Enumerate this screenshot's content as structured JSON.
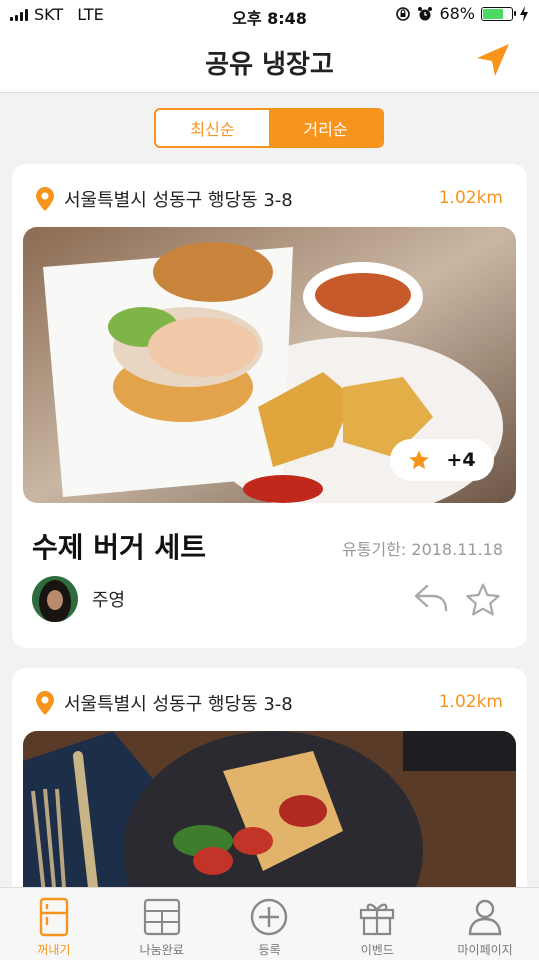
{
  "status_bar": {
    "carrier": "SKT",
    "network": "LTE",
    "time": "오후 8:48",
    "battery": "68%"
  },
  "header": {
    "title": "공유 냉장고"
  },
  "sort_tabs": [
    {
      "label": "최신순",
      "active": false
    },
    {
      "label": "거리순",
      "active": true
    }
  ],
  "cards": [
    {
      "location": "서울특별시 성동구 행당동 3-8",
      "distance": "1.02km",
      "photo_count": "+4",
      "title": "수제 버거 세트",
      "expiry": "유통기한: 2018.11.18",
      "user": "주영"
    },
    {
      "location": "서울특별시 성동구 행당동 3-8",
      "distance": "1.02km"
    }
  ],
  "tab_bar": [
    {
      "label": "꺼내기",
      "icon": "fridge-icon",
      "active": true
    },
    {
      "label": "나눔완료",
      "icon": "shelf-icon",
      "active": false
    },
    {
      "label": "등록",
      "icon": "plus-circle-icon",
      "active": false
    },
    {
      "label": "이벤드",
      "icon": "gift-icon",
      "active": false
    },
    {
      "label": "마이페이지",
      "icon": "person-icon",
      "active": false
    }
  ],
  "colors": {
    "accent": "#f7941d",
    "background": "#f2f2f2"
  }
}
